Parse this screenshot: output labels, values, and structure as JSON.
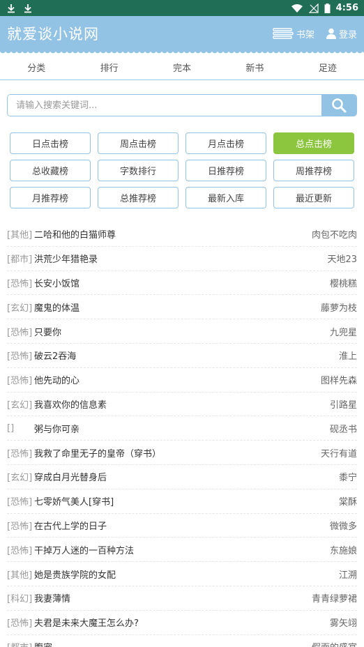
{
  "statusbar": {
    "time": "4:56"
  },
  "header": {
    "title": "就爱谈小说网",
    "bookshelf": "书架",
    "login": "登录"
  },
  "nav": [
    "分类",
    "排行",
    "完本",
    "新书",
    "足迹"
  ],
  "search": {
    "placeholder": "请输入搜索关键词..."
  },
  "rank_buttons": [
    {
      "label": "日点击榜",
      "active": false
    },
    {
      "label": "周点击榜",
      "active": false
    },
    {
      "label": "月点击榜",
      "active": false
    },
    {
      "label": "总点击榜",
      "active": true
    },
    {
      "label": "总收藏榜",
      "active": false
    },
    {
      "label": "字数排行",
      "active": false
    },
    {
      "label": "日推荐榜",
      "active": false
    },
    {
      "label": "周推荐榜",
      "active": false
    },
    {
      "label": "月推荐榜",
      "active": false
    },
    {
      "label": "总推荐榜",
      "active": false
    },
    {
      "label": "最新入库",
      "active": false
    },
    {
      "label": "最近更新",
      "active": false
    }
  ],
  "books": [
    {
      "cat": "[其他]",
      "name": "二哈和他的白猫师尊",
      "author": "肉包不吃肉"
    },
    {
      "cat": "[都市]",
      "name": "洪荒少年猎艳录",
      "author": "天地23"
    },
    {
      "cat": "[恐怖]",
      "name": "长安小饭馆",
      "author": "樱桃糕"
    },
    {
      "cat": "[玄幻]",
      "name": "魔鬼的体温",
      "author": "藤萝为枝"
    },
    {
      "cat": "[恐怖]",
      "name": "只要你",
      "author": "九兜星"
    },
    {
      "cat": "[恐怖]",
      "name": "破云2吞海",
      "author": "淮上"
    },
    {
      "cat": "[恐怖]",
      "name": "他先动的心",
      "author": "图样先森"
    },
    {
      "cat": "[玄幻]",
      "name": "我喜欢你的信息素",
      "author": "引路星"
    },
    {
      "cat": "[]",
      "name": "粥与你可亲",
      "author": "砚丞书"
    },
    {
      "cat": "[恐怖]",
      "name": "我救了命里无子的皇帝（穿书）",
      "author": "天行有道"
    },
    {
      "cat": "[玄幻]",
      "name": "穿成白月光替身后",
      "author": "黍宁"
    },
    {
      "cat": "[恐怖]",
      "name": "七零娇气美人[穿书]",
      "author": "棠酥"
    },
    {
      "cat": "[恐怖]",
      "name": "在古代上学的日子",
      "author": "微微多"
    },
    {
      "cat": "[恐怖]",
      "name": "干掉万人迷的一百种方法",
      "author": "东施娘"
    },
    {
      "cat": "[其他]",
      "name": "她是贵族学院的女配",
      "author": "江溯"
    },
    {
      "cat": "[科幻]",
      "name": "我妻薄情",
      "author": "青青绿萝裙"
    },
    {
      "cat": "[恐怖]",
      "name": "夫君是未来大魔王怎么办?",
      "author": "雾矢翊"
    },
    {
      "cat": "[都市]",
      "name": "腹宠",
      "author": "假面的盛宴"
    }
  ]
}
